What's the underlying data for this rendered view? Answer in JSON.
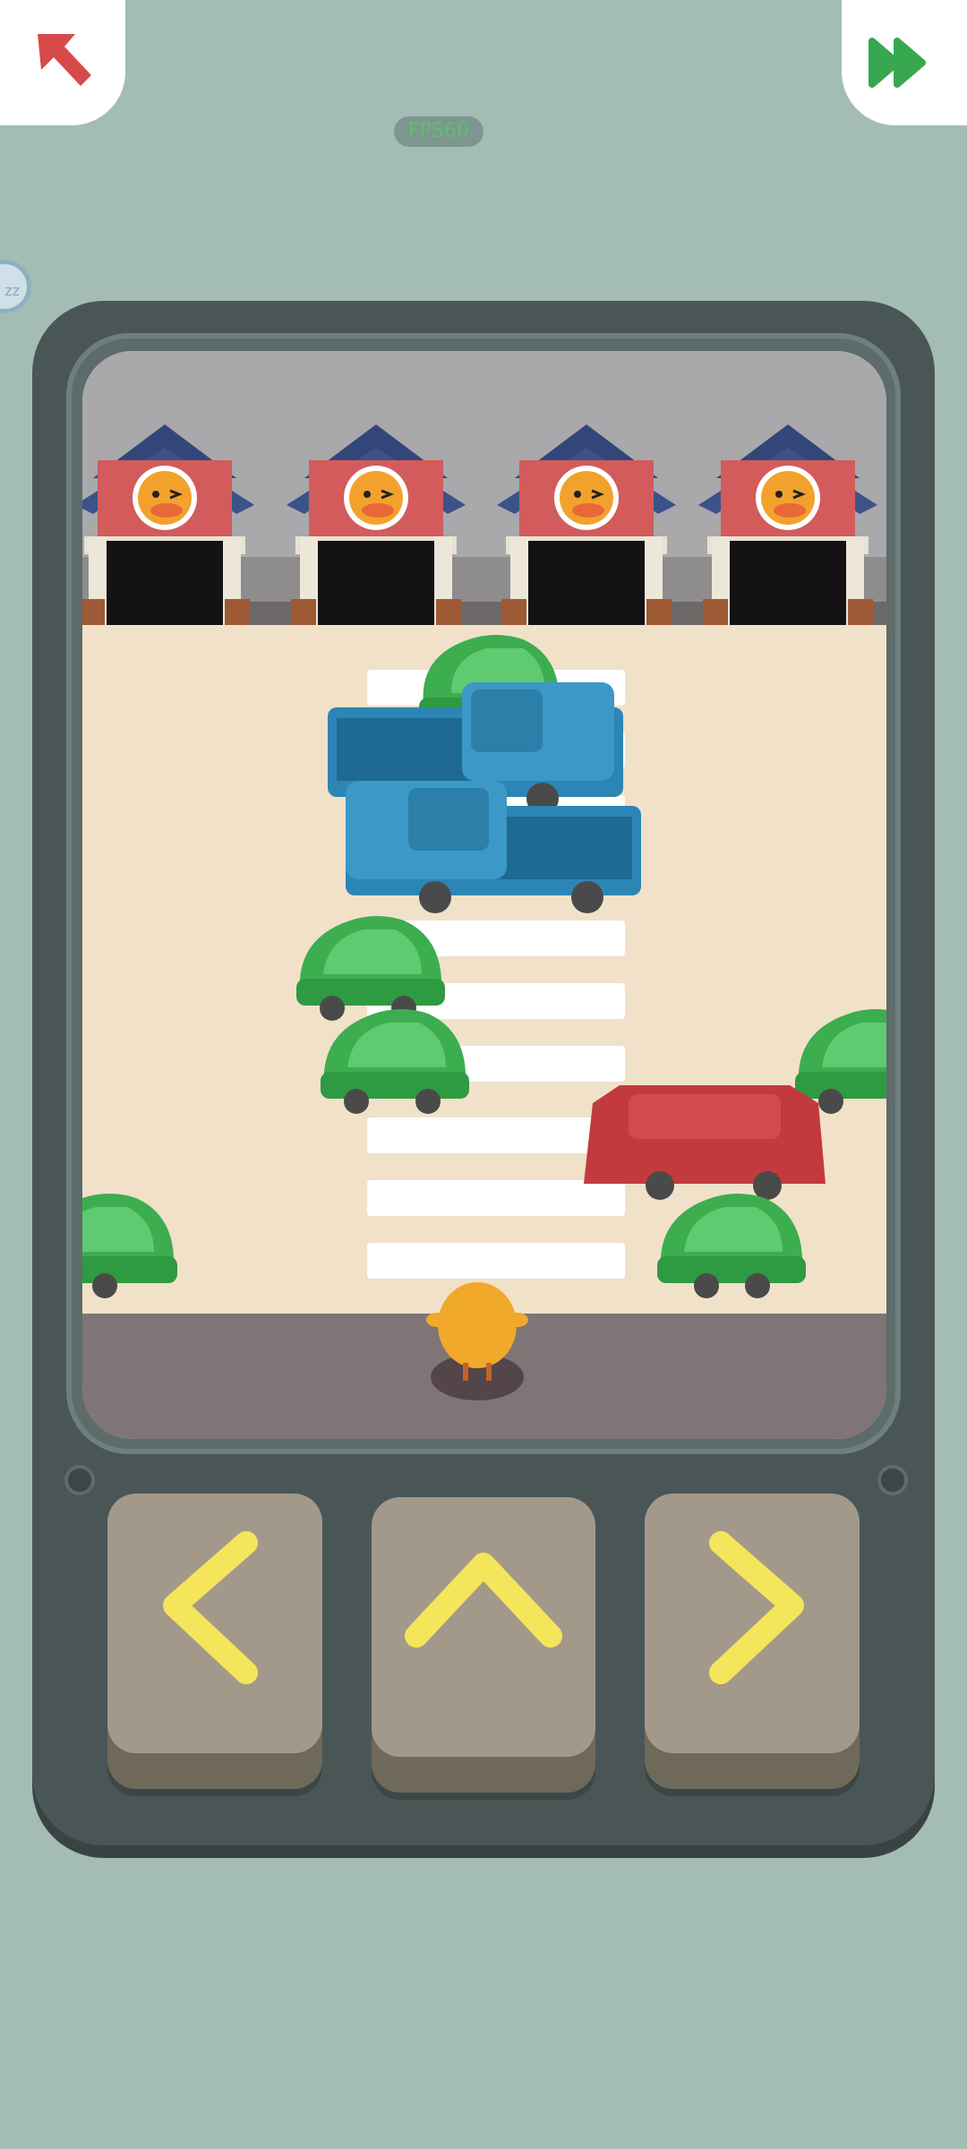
{
  "hud": {
    "fps_label": "FPS60",
    "sleep_label": "zz",
    "back_icon": "arrow-up-left-icon",
    "skip_icon": "fast-forward-icon"
  },
  "colors": {
    "background": "#a3bdb4",
    "back_arrow": "#d84a4a",
    "skip_arrow": "#37a850",
    "control_arrow": "#f5e55a",
    "car_green": "#3cae4f",
    "truck_blue": "#2c86b5",
    "car_red": "#c23a3e",
    "chick": "#f0a92a"
  },
  "controls": {
    "left": "chevron-left-icon",
    "up": "chevron-up-icon",
    "right": "chevron-right-icon"
  },
  "scene": {
    "garages": 4,
    "crosswalk_stripes": 10,
    "vehicles": [
      "green-car",
      "blue-truck",
      "blue-truck",
      "green-car",
      "green-car",
      "green-car",
      "red-car",
      "green-car",
      "green-car"
    ]
  }
}
